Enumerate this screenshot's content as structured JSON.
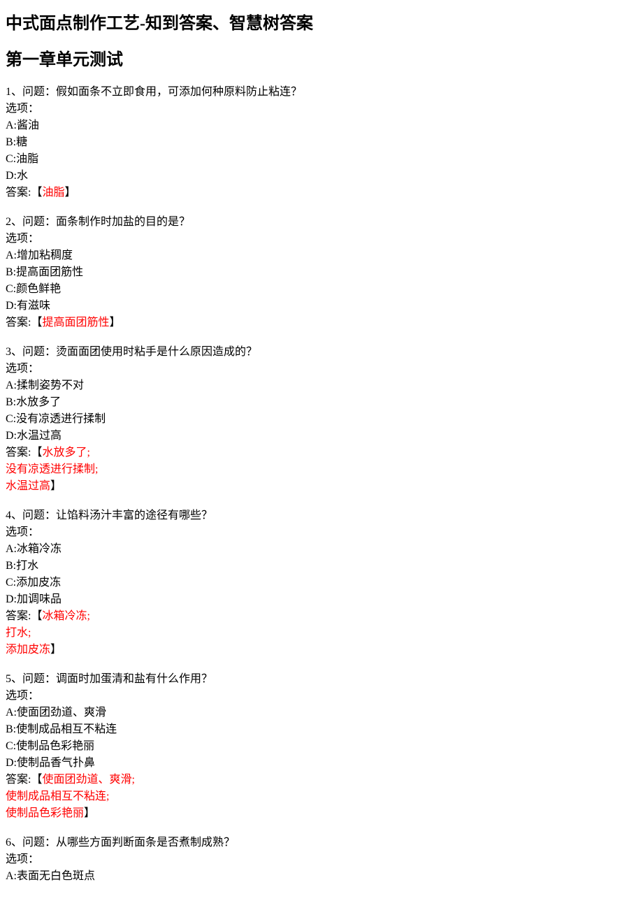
{
  "title": "中式面点制作工艺-知到答案、智慧树答案",
  "chapter": "第一章单元测试",
  "questions": [
    {
      "num": "1",
      "question": "1、问题：假如面条不立即食用，可添加何种原料防止粘连？",
      "options_label": "选项：",
      "options": [
        "A:酱油",
        "B:糖",
        "C:油脂",
        "D:水"
      ],
      "answer_prefix": "答案:【",
      "answer_lines": [
        "油脂"
      ],
      "answer_suffix": "】"
    },
    {
      "num": "2",
      "question": "2、问题：面条制作时加盐的目的是？",
      "options_label": "选项：",
      "options": [
        "A:增加粘稠度",
        "B:提高面团筋性",
        "C:颜色鲜艳",
        "D:有滋味"
      ],
      "answer_prefix": "答案:【",
      "answer_lines": [
        "提高面团筋性"
      ],
      "answer_suffix": "】"
    },
    {
      "num": "3",
      "question": "3、问题：烫面面团使用时粘手是什么原因造成的？",
      "options_label": "选项：",
      "options": [
        "A:揉制姿势不对",
        "B:水放多了",
        "C:没有凉透进行揉制",
        "D:水温过高"
      ],
      "answer_prefix": "答案:【",
      "answer_lines": [
        "水放多了;",
        "没有凉透进行揉制;",
        "水温过高"
      ],
      "answer_suffix": "】"
    },
    {
      "num": "4",
      "question": "4、问题：让馅料汤汁丰富的途径有哪些？",
      "options_label": "选项：",
      "options": [
        "A:冰箱冷冻",
        "B:打水",
        "C:添加皮冻",
        "D:加调味品"
      ],
      "answer_prefix": "答案:【",
      "answer_lines": [
        "冰箱冷冻;",
        "打水;",
        "添加皮冻"
      ],
      "answer_suffix": "】"
    },
    {
      "num": "5",
      "question": "5、问题：调面时加蛋清和盐有什么作用？",
      "options_label": "选项：",
      "options": [
        "A:使面团劲道、爽滑",
        "B:使制成品相互不粘连",
        "C:使制品色彩艳丽",
        "D:使制品香气扑鼻"
      ],
      "answer_prefix": "答案:【",
      "answer_lines": [
        "使面团劲道、爽滑;",
        "使制成品相互不粘连;",
        "使制品色彩艳丽"
      ],
      "answer_suffix": "】"
    },
    {
      "num": "6",
      "question": "6、问题：从哪些方面判断面条是否煮制成熟？",
      "options_label": "选项：",
      "options": [
        "A:表面无白色斑点"
      ],
      "answer_prefix": "",
      "answer_lines": [],
      "answer_suffix": ""
    }
  ]
}
